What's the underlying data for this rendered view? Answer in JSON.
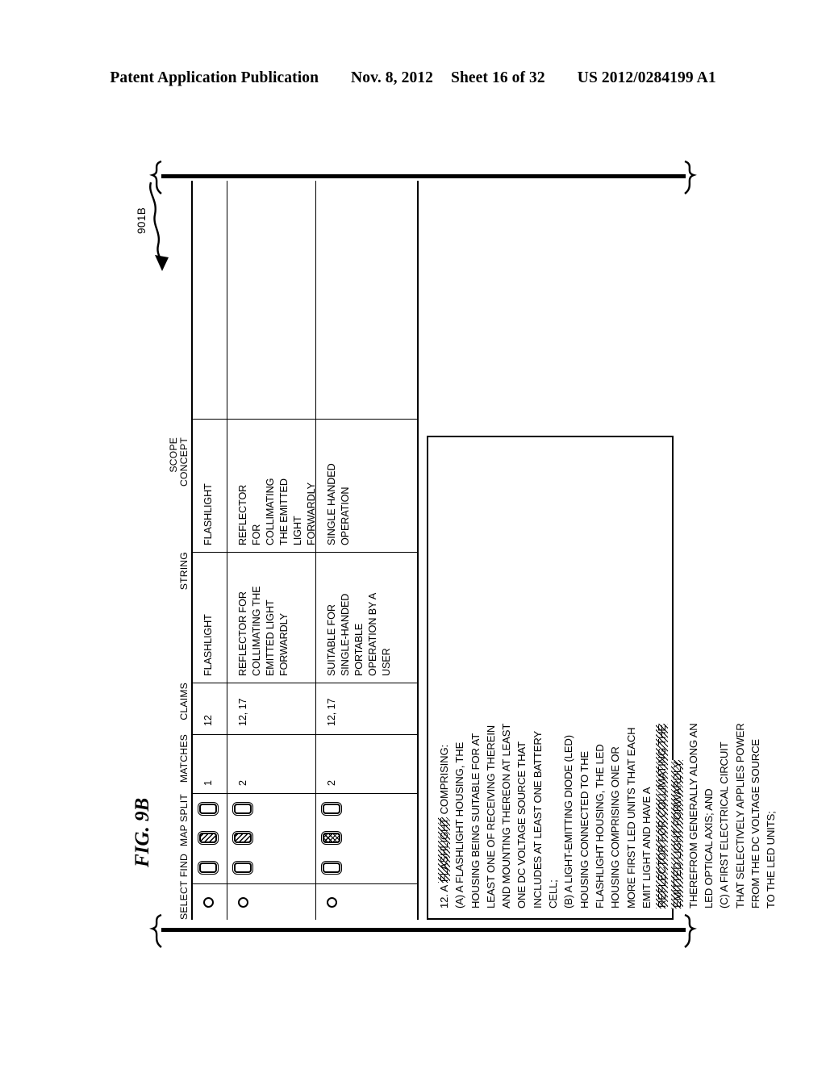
{
  "header": {
    "publication": "Patent Application Publication",
    "date": "Nov. 8, 2012",
    "sheet": "Sheet 16 of 32",
    "number": "US 2012/0284199 A1"
  },
  "figure": {
    "label": "FIG. 9B",
    "reference_numeral": "901B"
  },
  "table": {
    "columns": [
      {
        "key": "select",
        "label": "SELECT"
      },
      {
        "key": "find",
        "label": "FIND"
      },
      {
        "key": "map",
        "label": "MAP"
      },
      {
        "key": "split",
        "label": "SPLIT"
      },
      {
        "key": "matches",
        "label": "MATCHES"
      },
      {
        "key": "claims",
        "label": "CLAIMS"
      },
      {
        "key": "string",
        "label": "STRING"
      },
      {
        "key": "scope",
        "label": "SCOPE\nCONCEPT"
      }
    ],
    "rows": [
      {
        "select": "radio",
        "find": "plain",
        "map": "diagonal",
        "split": "plain",
        "matches": "1",
        "claims": "12",
        "string": "FLASHLIGHT",
        "scope": "FLASHLIGHT"
      },
      {
        "select": "radio",
        "find": "plain",
        "map": "diagonal",
        "split": "plain",
        "matches": "2",
        "claims": "12, 17",
        "string": "REFLECTOR FOR\nCOLLIMATING THE\nEMITTED LIGHT\nFORWARDLY",
        "scope": "REFLECTOR\nFOR\nCOLLIMATING\nTHE EMITTED\nLIGHT\nFORWARDLY"
      },
      {
        "select": "radio",
        "find": "plain",
        "map": "crosshatch",
        "split": "plain",
        "matches": "2",
        "claims": "12, 17",
        "string": "SUITABLE FOR\nSINGLE-HANDED\nPORTABLE\nOPERATION BY A\nUSER",
        "scope": "SINGLE HANDED\nOPERATION"
      }
    ]
  },
  "claim_panel": {
    "lines": [
      {
        "pre": "12. A ",
        "mark": "FLASHLIGHT",
        "post": " COMPRISING:"
      },
      {
        "pre": "(A) A FLASHLIGHT HOUSING, THE",
        "mark": "",
        "post": ""
      },
      {
        "pre": "HOUSING BEING SUITABLE FOR AT",
        "mark": "",
        "post": ""
      },
      {
        "pre": "LEAST ONE OF RECEIVING THEREIN",
        "mark": "",
        "post": ""
      },
      {
        "pre": "AND MOUNTING THEREON AT LEAST",
        "mark": "",
        "post": ""
      },
      {
        "pre": "ONE DC VOLTAGE SOURCE THAT",
        "mark": "",
        "post": ""
      },
      {
        "pre": "INCLUDES AT LEAST ONE BATTERY",
        "mark": "",
        "post": ""
      },
      {
        "pre": "CELL;",
        "mark": "",
        "post": ""
      },
      {
        "pre": "(B) A LIGHT-EMITTING DIODE (LED)",
        "mark": "",
        "post": ""
      },
      {
        "pre": "HOUSING CONNECTED TO THE",
        "mark": "",
        "post": ""
      },
      {
        "pre": "FLASHLIGHT HOUSING, THE LED",
        "mark": "",
        "post": ""
      },
      {
        "pre": "HOUSING COMPRISING ONE OR",
        "mark": "",
        "post": ""
      },
      {
        "pre": "MORE FIRST LED UNITS THAT EACH",
        "mark": "",
        "post": ""
      },
      {
        "pre": "EMIT LIGHT AND HAVE A",
        "mark": "",
        "post": ""
      },
      {
        "pre": "",
        "mark": "REFLECTOR FOR COLLIMATING THE",
        "post": ""
      },
      {
        "pre": "",
        "mark": "EMITTED LIGHT FORWARDLY",
        "post": ""
      },
      {
        "pre": "THEREFROM GENERALLY ALONG AN",
        "mark": "",
        "post": ""
      },
      {
        "pre": "LED OPTICAL AXIS; AND",
        "mark": "",
        "post": ""
      },
      {
        "pre": "(C) A FIRST ELECTRICAL CIRCUIT",
        "mark": "",
        "post": ""
      },
      {
        "pre": "THAT SELECTIVELY APPLIES POWER",
        "mark": "",
        "post": ""
      },
      {
        "pre": "FROM THE DC VOLTAGE SOURCE",
        "mark": "",
        "post": ""
      },
      {
        "pre": "TO THE LED UNITS;",
        "mark": "",
        "post": ""
      }
    ]
  },
  "colors": {
    "ink": "#000000",
    "paper": "#ffffff"
  }
}
